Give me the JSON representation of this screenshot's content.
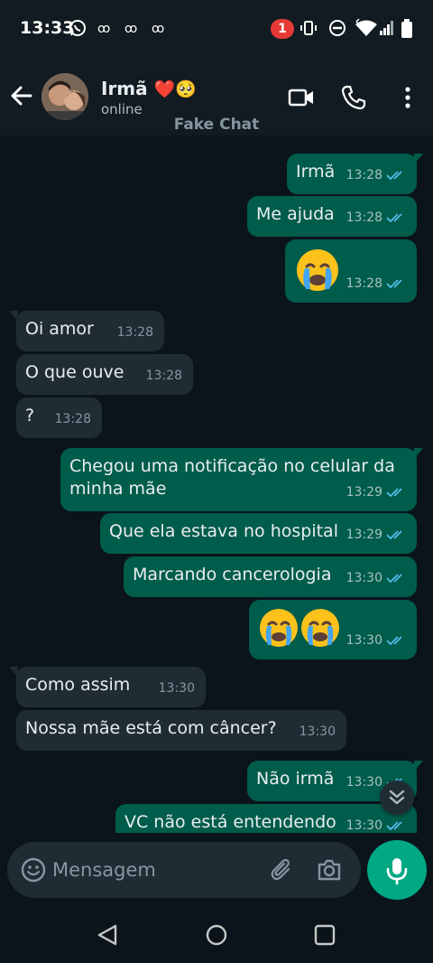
{
  "status_bar": {
    "time": "13:33",
    "notification_count": "1",
    "icons": [
      "whatsapp-icon",
      "alarm-icon",
      "vibrate-icon",
      "dnd-icon",
      "wifi-icon",
      "signal-icon",
      "battery-icon"
    ]
  },
  "header": {
    "contact_name": "Irmã",
    "name_emojis": "❤️🥺",
    "status": "online",
    "watermark": "Fake Chat",
    "icons": [
      "back-arrow-icon",
      "video-call-icon",
      "phone-icon",
      "more-vert-icon"
    ]
  },
  "messages": [
    {
      "dir": "out",
      "text": "Irmã",
      "time": "13:28",
      "read": true
    },
    {
      "dir": "out",
      "text": "Me ajuda",
      "time": "13:28",
      "read": true
    },
    {
      "dir": "out",
      "emoji": "😭",
      "time": "13:28",
      "read": true
    },
    {
      "dir": "in",
      "text": "Oi amor",
      "time": "13:28"
    },
    {
      "dir": "in",
      "text": "O que ouve",
      "time": "13:28"
    },
    {
      "dir": "in",
      "text": "?",
      "time": "13:28"
    },
    {
      "dir": "out",
      "text": "Chegou uma notificação no celular da minha mãe",
      "time": "13:29",
      "read": true
    },
    {
      "dir": "out",
      "text": "Que ela estava no hospital",
      "time": "13:29",
      "read": true
    },
    {
      "dir": "out",
      "text": "Marcando cancerologia",
      "time": "13:30",
      "read": true
    },
    {
      "dir": "out",
      "emoji": "😭😭",
      "time": "13:30",
      "read": true
    },
    {
      "dir": "in",
      "text": "Como assim",
      "time": "13:30"
    },
    {
      "dir": "in",
      "text": "Nossa mãe está com câncer?",
      "time": "13:30"
    },
    {
      "dir": "out",
      "text": "Não irmã",
      "time": "13:30",
      "read": true
    },
    {
      "dir": "out",
      "text": "VC não está entendendo",
      "time": "13:30",
      "read": true
    }
  ],
  "composer": {
    "placeholder": "Mensagem",
    "icons": [
      "emoji-icon",
      "attach-icon",
      "camera-icon",
      "mic-icon"
    ]
  },
  "colors": {
    "background": "#0b141a",
    "outgoing_bubble": "#005c4b",
    "incoming_bubble": "#202c33",
    "accent": "#00a884",
    "read_ticks": "#53bdeb"
  }
}
